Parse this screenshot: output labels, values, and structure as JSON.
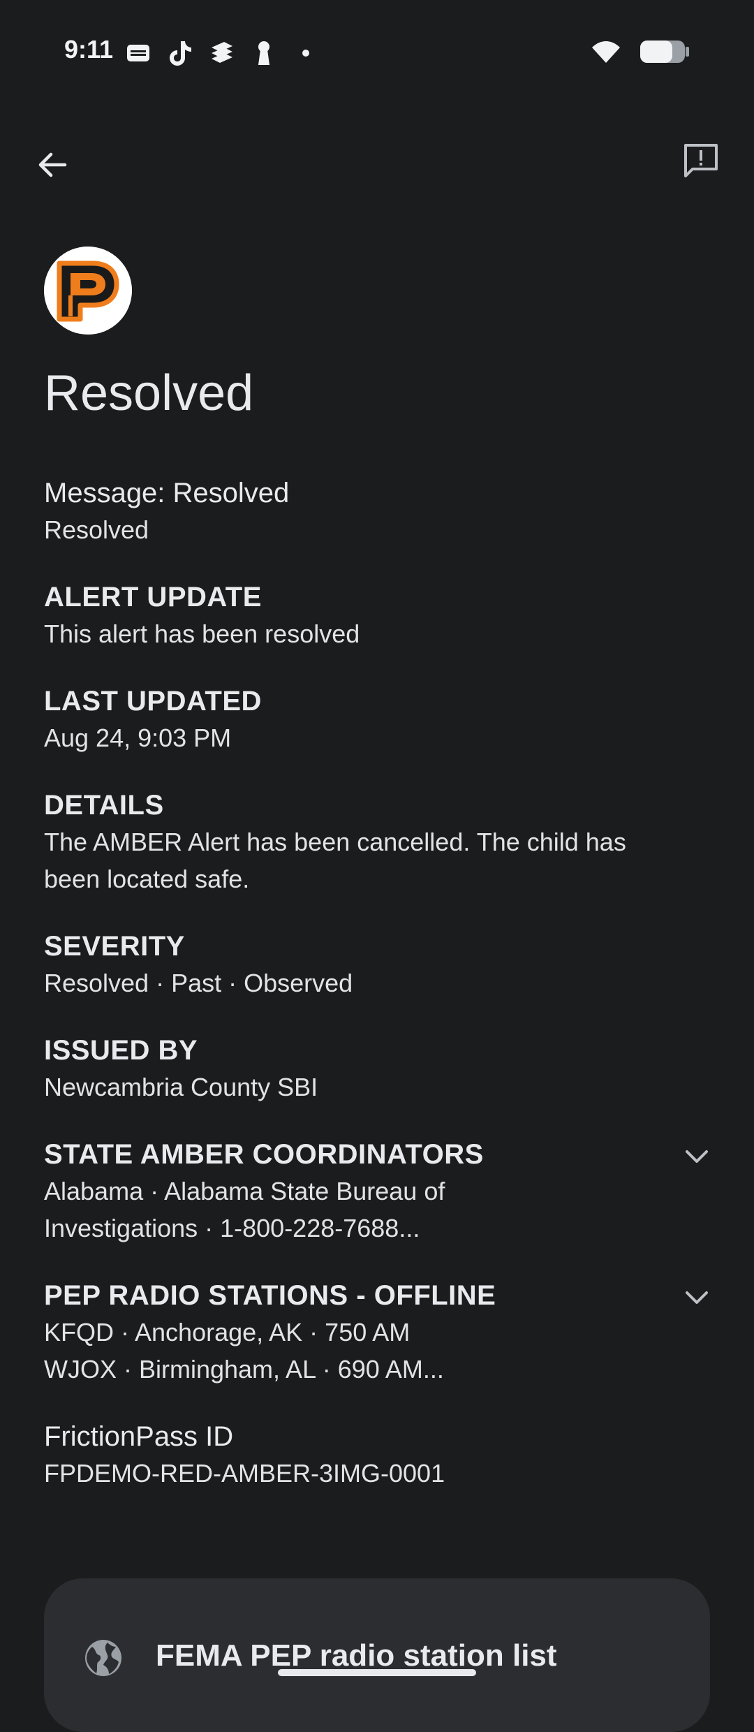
{
  "status_bar": {
    "time": "9:11"
  },
  "header": {
    "title": "Resolved"
  },
  "sections": {
    "message": {
      "heading": "Message: Resolved",
      "body": "Resolved"
    },
    "alert_update": {
      "heading": "ALERT UPDATE",
      "body": "This alert has been resolved"
    },
    "last_updated": {
      "heading": "LAST UPDATED",
      "body": "Aug 24, 9:03 PM"
    },
    "details": {
      "heading": "DETAILS",
      "body_lines": [
        "The AMBER Alert has been cancelled. The child has",
        "been located safe."
      ]
    },
    "severity": {
      "heading": "SEVERITY",
      "body": "Resolved · Past · Observed"
    },
    "issued_by": {
      "heading": "ISSUED BY",
      "body": "Newcambria County SBI"
    },
    "state_amber_coordinators": {
      "heading": "STATE AMBER COORDINATORS",
      "body_lines": [
        "Alabama · Alabama State Bureau of",
        "Investigations · 1-800-228-7688..."
      ]
    },
    "pep_radio_stations": {
      "heading": "PEP RADIO STATIONS - OFFLINE",
      "body_lines": [
        "KFQD · Anchorage, AK · 750 AM",
        "WJOX · Birmingham, AL · 690 AM..."
      ]
    },
    "frictionpass_id": {
      "heading": "FrictionPass ID",
      "body": "FPDEMO-RED-AMBER-3IMG-0001"
    }
  },
  "link_card": {
    "label": "FEMA PEP radio station list",
    "icon": "globe-icon"
  },
  "icons": {
    "back": "arrow-back-icon",
    "feedback": "feedback-icon",
    "expand": "chevron-down-icon"
  },
  "colors": {
    "background": "#1b1c1e",
    "card": "#2c2d30",
    "logo_orange": "#f07d1c"
  }
}
